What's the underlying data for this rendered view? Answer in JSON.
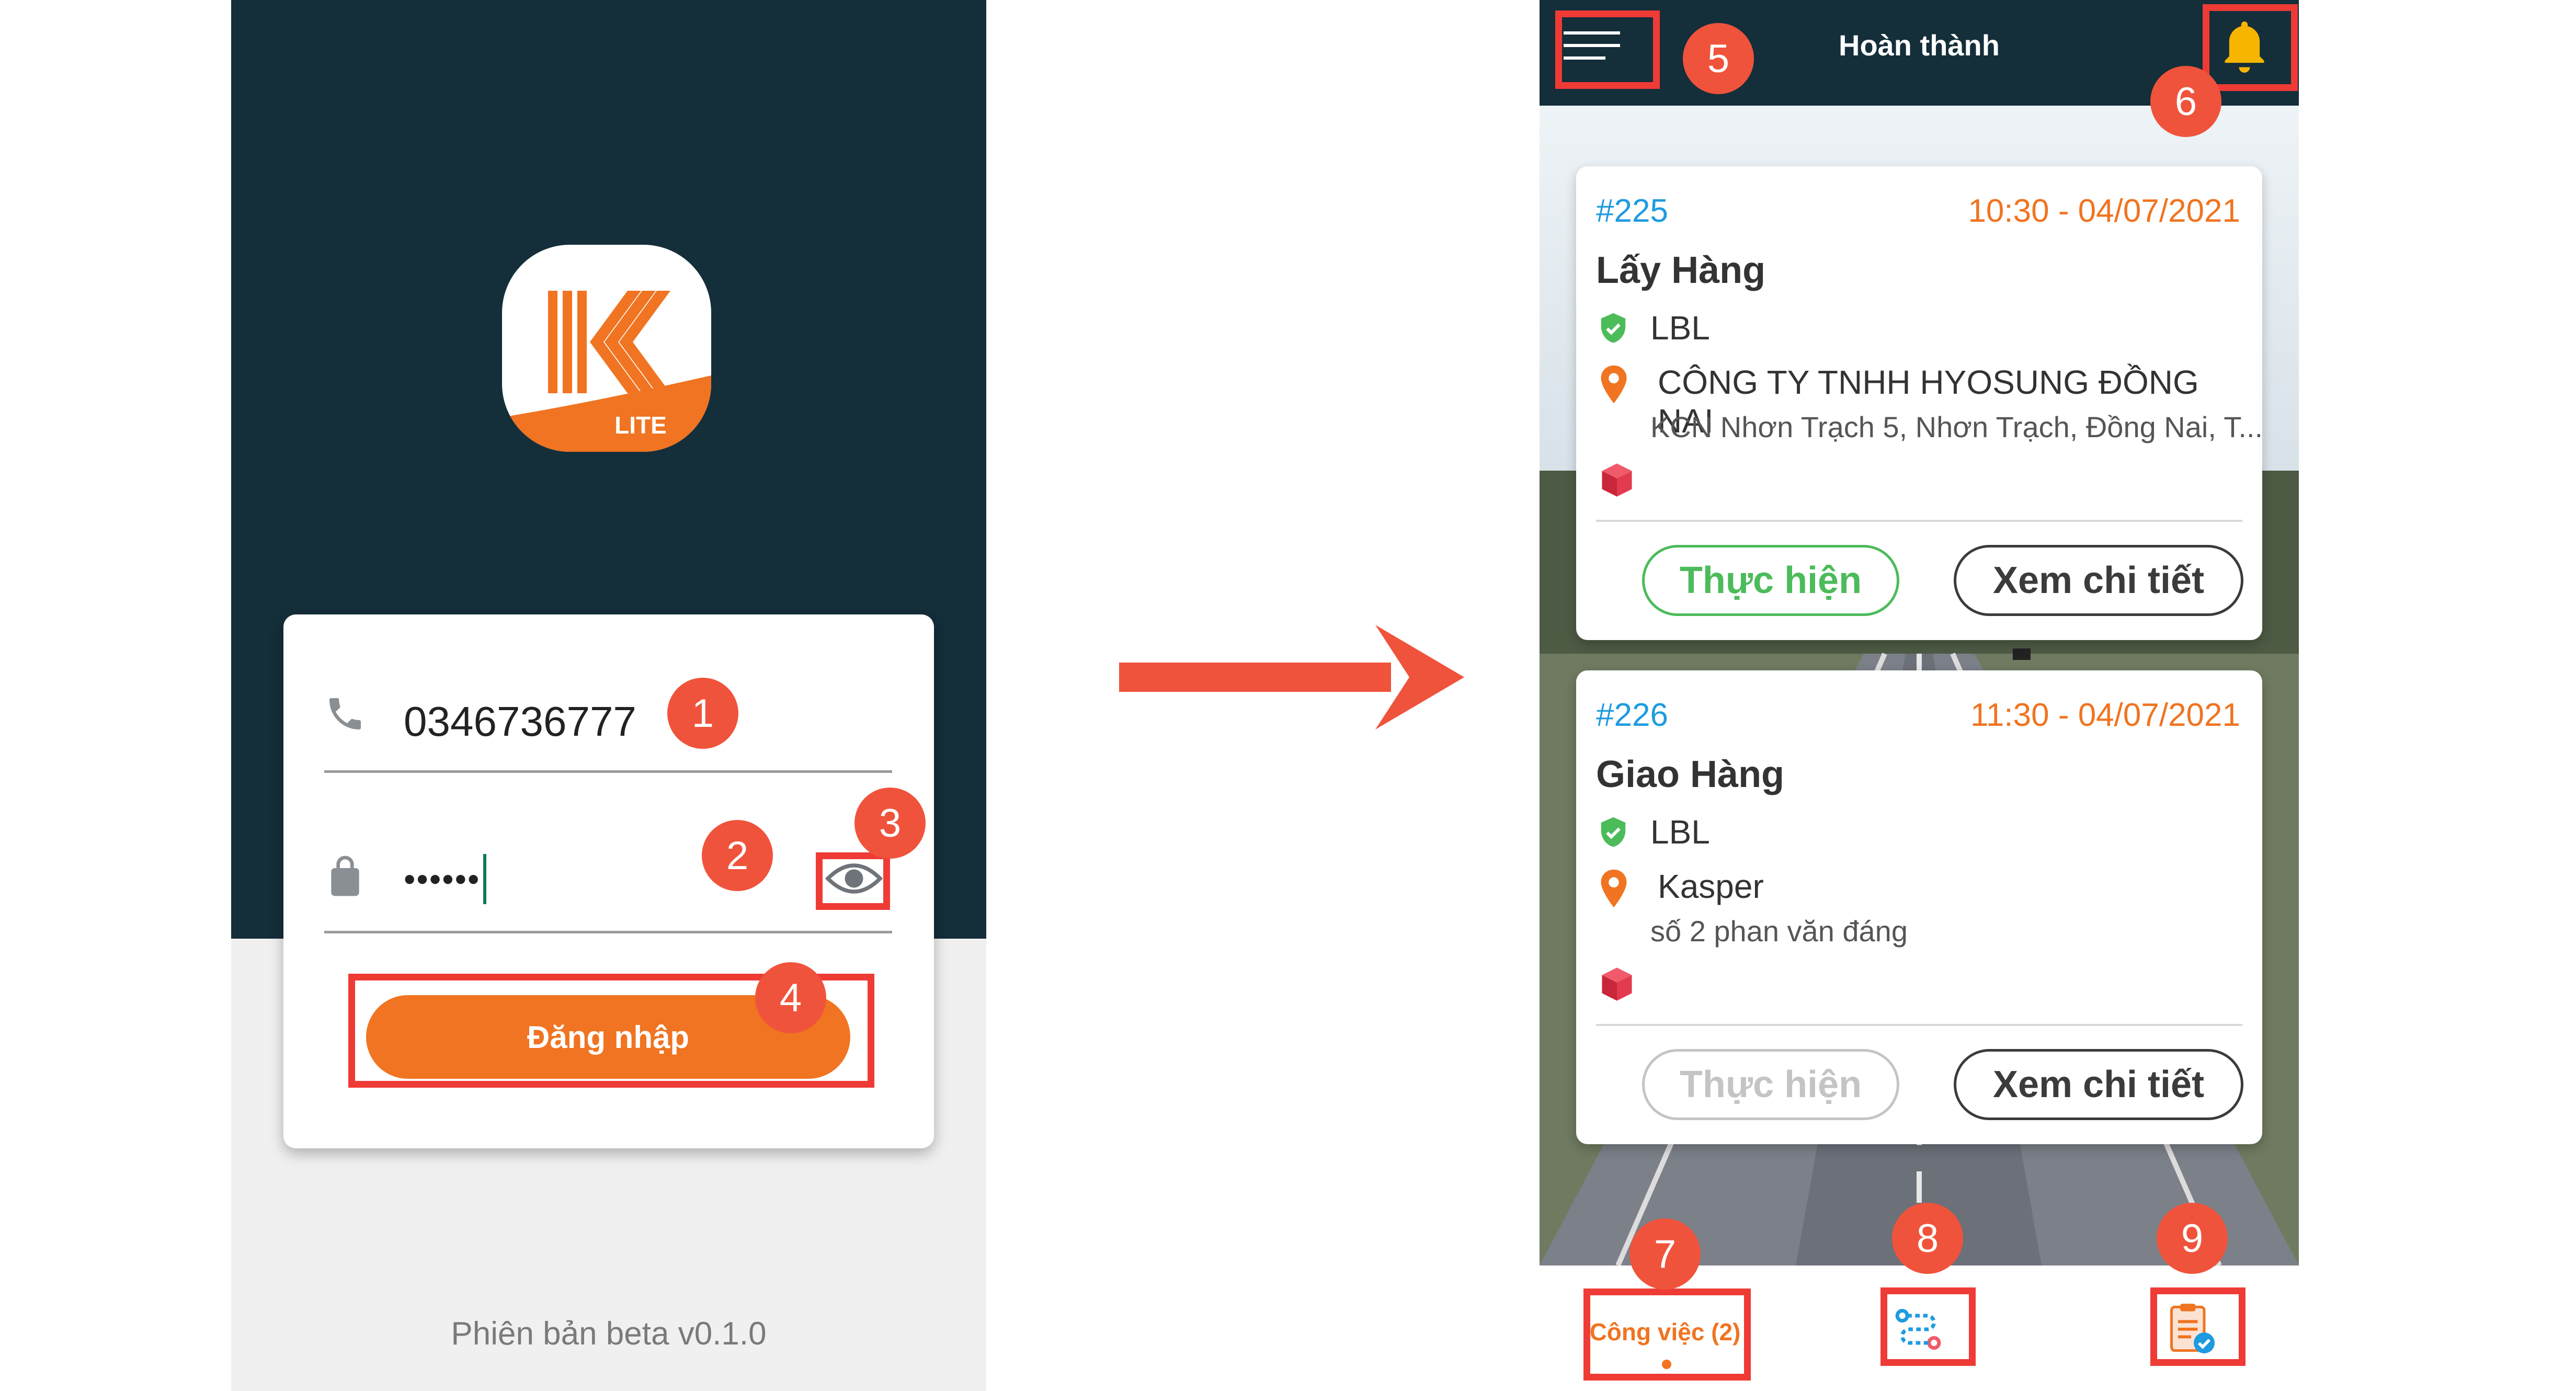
{
  "login": {
    "logo_caption": "LITE",
    "phone_value": "0346736777",
    "password_value": "••••••",
    "login_button": "Đăng nhập",
    "version": "Phiên bản beta v0.1.0"
  },
  "task_list": {
    "header_title": "Hoàn thành",
    "tasks": [
      {
        "id": "#225",
        "time": "10:30 - 04/07/2021",
        "title": "Lấy Hàng",
        "company": "LBL",
        "address_name": "CÔNG TY TNHH HYOSUNG ĐỒNG NAI",
        "address_line": "KCN Nhơn Trạch 5, Nhơn Trạch, Đồng Nai, T...",
        "execute_label": "Thực hiện",
        "execute_enabled": true,
        "detail_label": "Xem chi tiết"
      },
      {
        "id": "#226",
        "time": "11:30 - 04/07/2021",
        "title": "Giao Hàng",
        "company": "LBL",
        "address_name": "Kasper",
        "address_line": "số 2 phan văn đáng",
        "execute_label": "Thực hiện",
        "execute_enabled": false,
        "detail_label": "Xem chi tiết"
      }
    ],
    "bottom_nav": {
      "jobs_label": "Công việc (2)",
      "route_icon": "route-icon",
      "report_icon": "clipboard-check-icon"
    }
  },
  "annotations": {
    "badges": [
      "1",
      "2",
      "3",
      "4",
      "5",
      "6",
      "7",
      "8",
      "9"
    ]
  },
  "colors": {
    "primary_orange": "#f07421",
    "dark_header": "#142e3a",
    "annotation_red": "#ef3b36",
    "success_green": "#4cbb5a",
    "id_blue": "#1e9be0"
  }
}
